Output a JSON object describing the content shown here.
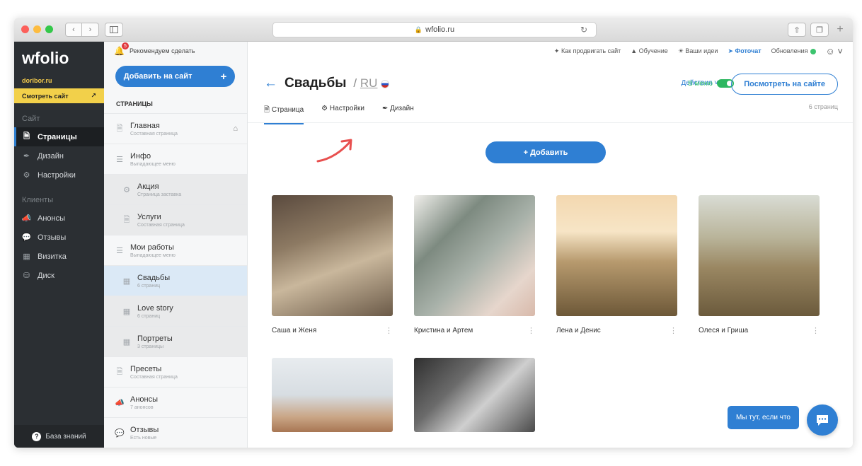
{
  "browser": {
    "url": "wfolio.ru"
  },
  "leftnav": {
    "logo": "wfolio",
    "domain": "doribor.ru",
    "view_site": "Смотреть сайт",
    "section_site": "Сайт",
    "items_site": [
      {
        "label": "Страницы",
        "icon": "page-icon",
        "active": true
      },
      {
        "label": "Дизайн",
        "icon": "brush-icon"
      },
      {
        "label": "Настройки",
        "icon": "gear-icon"
      }
    ],
    "section_clients": "Клиенты",
    "items_clients": [
      {
        "label": "Анонсы",
        "icon": "megaphone-icon"
      },
      {
        "label": "Отзывы",
        "icon": "comments-icon"
      },
      {
        "label": "Визитка",
        "icon": "card-icon"
      },
      {
        "label": "Диск",
        "icon": "disk-icon"
      }
    ],
    "knowledge_base": "База знаний"
  },
  "pages_panel": {
    "recommend": "Рекомендуем сделать",
    "badge_count": "5",
    "add_button": "Добавить на сайт",
    "title": "СТРАНИЦЫ",
    "items": [
      {
        "name": "Главная",
        "sub": "Составная страница"
      },
      {
        "name": "Инфо",
        "sub": "Выпадающее меню"
      },
      {
        "name": "Акция",
        "sub": "Страница заставка"
      },
      {
        "name": "Услуги",
        "sub": "Составная страница"
      },
      {
        "name": "Мои работы",
        "sub": "Выпадающее меню"
      },
      {
        "name": "Свадьбы",
        "sub": "6 страниц"
      },
      {
        "name": "Love story",
        "sub": "6 страниц"
      },
      {
        "name": "Портреты",
        "sub": "3 страницы"
      },
      {
        "name": "Пресеты",
        "sub": "Составная страница"
      },
      {
        "name": "Анонсы",
        "sub": "7 анонсов"
      },
      {
        "name": "Отзывы",
        "sub": "Есть новые"
      }
    ]
  },
  "topbar": {
    "promote": "Как продвигать сайт",
    "learning": "Обучение",
    "ideas": "Ваши идеи",
    "fotochat": "Фоточат",
    "updates": "Обновления"
  },
  "main": {
    "title": "Свадьбы",
    "lang": "RU",
    "actions": "Действия",
    "in_menu": "В меню",
    "view_on_site": "Посмотреть на сайте",
    "page_count": "6 страниц",
    "tabs": [
      "Страница",
      "Настройки",
      "Дизайн"
    ],
    "add_button": "+ Добавить",
    "cards": [
      {
        "title": "Саша и Женя"
      },
      {
        "title": "Кристина и Артем"
      },
      {
        "title": "Лена и Денис"
      },
      {
        "title": "Олеся и Гриша"
      }
    ],
    "chat_text": "Мы тут, если что"
  },
  "colors": {
    "accent": "#2f7fd3",
    "sidebar": "#2b2f33",
    "highlight": "#f2d04a",
    "green": "#3cc46e"
  }
}
